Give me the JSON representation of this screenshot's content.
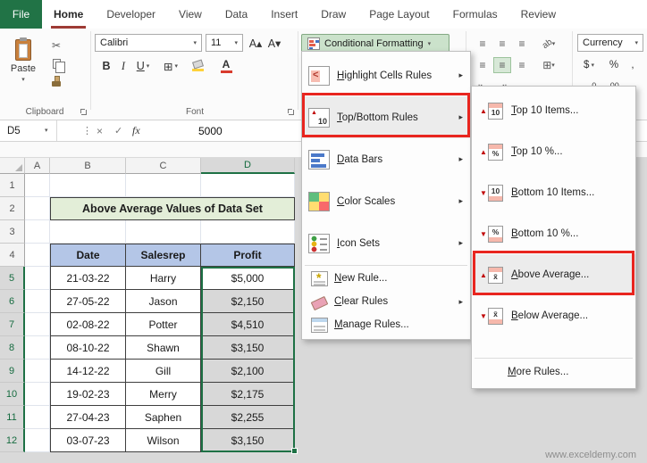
{
  "ribbon": {
    "file_tab": "File",
    "tabs": [
      "Home",
      "Developer",
      "View",
      "Data",
      "Insert",
      "Draw",
      "Page Layout",
      "Formulas",
      "Review"
    ],
    "active_tab": "Home",
    "clipboard": {
      "label": "Clipboard",
      "paste_label": "Paste"
    },
    "font_group": {
      "label": "Font",
      "font_name": "Calibri",
      "font_size": "11",
      "bold": "B",
      "italic": "I",
      "underline": "U"
    },
    "cf_label": "Conditional Formatting",
    "number_group": {
      "format": "Currency",
      "currency": "$",
      "percent": "%",
      "comma": ","
    }
  },
  "icons": {
    "caret": "▾",
    "submenu_arrow": "▸",
    "cut": "✂",
    "align": "≡",
    "borders": "⊞",
    "merge": "⊞",
    "orientation": "ab",
    "grow_font": "A▴",
    "shrink_font": "A▾",
    "indent_dec": "⇤",
    "indent_inc": "⇥",
    "cancel": "×",
    "check": "✓",
    "fx": "fx",
    "dots": "⋮",
    "font_color_letter": "A",
    "inc_decimal": "←.0",
    "dec_decimal": ".00→"
  },
  "formula_bar": {
    "name_box": "D5",
    "value": "5000"
  },
  "cf_menu": {
    "items": [
      {
        "label": "Highlight Cells Rules"
      },
      {
        "label": "Top/Bottom Rules"
      },
      {
        "label": "Data Bars"
      },
      {
        "label": "Color Scales"
      },
      {
        "label": "Icon Sets"
      },
      {
        "label": "New Rule..."
      },
      {
        "label": "Clear Rules"
      },
      {
        "label": "Manage Rules..."
      }
    ]
  },
  "tb_submenu": {
    "items": [
      {
        "label": "Top 10 Items...",
        "icon_text": "10",
        "arrow": "▲"
      },
      {
        "label": "Top 10 %...",
        "icon_text": "%",
        "arrow": "▲"
      },
      {
        "label": "Bottom 10 Items...",
        "icon_text": "10",
        "arrow": "▼"
      },
      {
        "label": "Bottom 10 %...",
        "icon_text": "%",
        "arrow": "▼"
      },
      {
        "label": "Above Average...",
        "icon_text": "x̄",
        "arrow": "▲"
      },
      {
        "label": "Below Average...",
        "icon_text": "x̄",
        "arrow": "▼"
      },
      {
        "label": "More Rules..."
      }
    ]
  },
  "sheet": {
    "col_headers": [
      "A",
      "B",
      "C",
      "D"
    ],
    "row_headers": [
      "1",
      "2",
      "3",
      "4",
      "5",
      "6",
      "7",
      "8",
      "9",
      "10",
      "11",
      "12"
    ],
    "title": "Above Average Values of Data Set",
    "table": {
      "headers": [
        "Date",
        "Salesrep",
        "Profit"
      ],
      "rows": [
        [
          "21-03-22",
          "Harry",
          "$5,000"
        ],
        [
          "27-05-22",
          "Jason",
          "$2,150"
        ],
        [
          "02-08-22",
          "Potter",
          "$4,510"
        ],
        [
          "08-10-22",
          "Shawn",
          "$3,150"
        ],
        [
          "14-12-22",
          "Gill",
          "$2,100"
        ],
        [
          "19-02-23",
          "Merry",
          "$2,175"
        ],
        [
          "27-04-23",
          "Saphen",
          "$2,255"
        ],
        [
          "03-07-23",
          "Wilson",
          "$3,150"
        ]
      ]
    },
    "active_cell": "D5"
  },
  "watermark": "www.exceldemy.com"
}
